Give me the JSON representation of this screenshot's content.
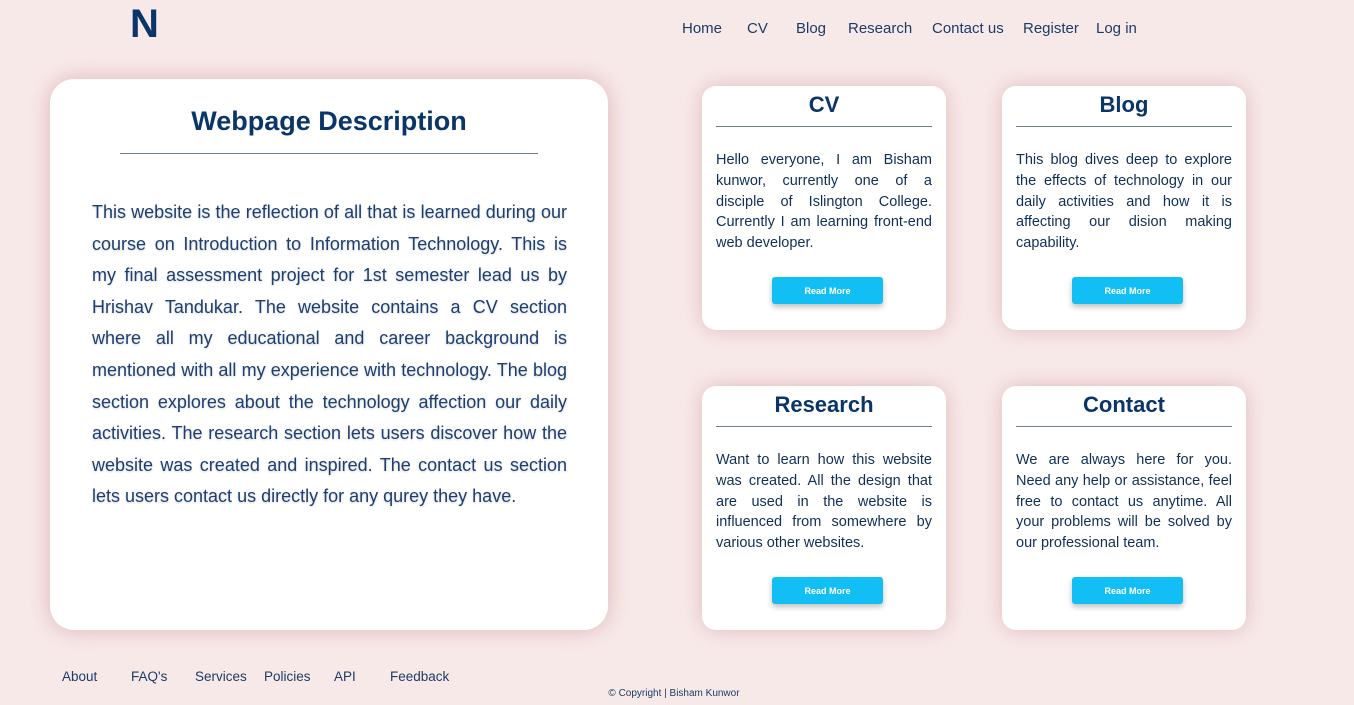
{
  "header": {
    "logo": "N",
    "nav": [
      "Home",
      "CV",
      "Blog",
      "Research",
      "Contact us",
      "Register",
      "Log in"
    ]
  },
  "description": {
    "title": "Webpage Description",
    "body": "This website is the reflection of all that is learned during our course on Introduction to Information Technology. This is my final assessment project for 1st semester lead us by Hrishav Tandukar. The website contains a CV section where all my educational and career background is mentioned with all my experience with technology. The blog section explores about the technology affection our daily activities. The research section lets users discover how the website was created and inspired. The contact us section lets users contact us directly for any qurey they have."
  },
  "cards": [
    {
      "title": "CV",
      "text": "Hello everyone, I am Bisham kunwor, currently one of a disciple of Islington College. Currently I am learning front-end web developer.",
      "button": "Read More"
    },
    {
      "title": "Blog",
      "text": "This blog dives deep to explore the effects of technology in our daily activities and how it is affecting our dision making capability.",
      "button": "Read More"
    },
    {
      "title": "Research",
      "text": "Want to learn how this website was created. All the design that are used in the website is influenced from somewhere by various other websites.",
      "button": "Read More"
    },
    {
      "title": "Contact",
      "text": "We are always here for you. Need any help or assistance, feel free to contact us anytime. All your problems will be solved by our professional team.",
      "button": "Read More"
    }
  ],
  "footer": {
    "links": [
      "About",
      "FAQ's",
      "Services",
      "Policies",
      "API",
      "Feedback"
    ],
    "copyright": "© Copyright | Bisham Kunwor"
  },
  "colors": {
    "background": "#f8e9e9",
    "primary_text": "#0a3569",
    "button": "#12bff5"
  }
}
